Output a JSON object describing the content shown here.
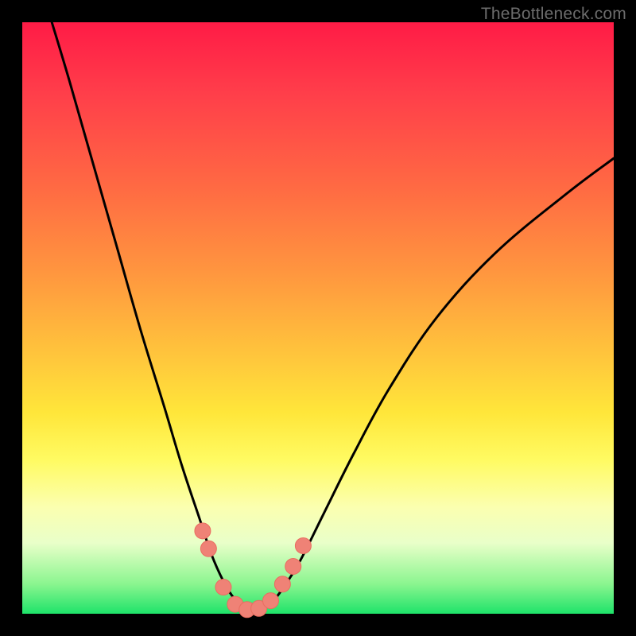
{
  "watermark": "TheBottleneck.com",
  "colors": {
    "curve_stroke": "#000000",
    "marker_fill": "#ef8276",
    "marker_stroke": "#e96d60",
    "frame": "#000000"
  },
  "chart_data": {
    "type": "line",
    "title": "",
    "xlabel": "",
    "ylabel": "",
    "xlim": [
      0,
      100
    ],
    "ylim": [
      0,
      100
    ],
    "grid": false,
    "legend": false,
    "series": [
      {
        "name": "bottleneck-curve",
        "x": [
          5,
          8,
          12,
          16,
          20,
          24,
          27,
          30,
          32,
          34,
          35.5,
          37,
          38.5,
          40,
          42,
          44,
          47,
          51,
          56,
          62,
          70,
          80,
          92,
          100
        ],
        "y": [
          100,
          90,
          76,
          62,
          48,
          35,
          25,
          16,
          10,
          5.5,
          3,
          1.3,
          0.6,
          0.7,
          1.8,
          4.2,
          9,
          17,
          27,
          38,
          50,
          61,
          71,
          77
        ]
      }
    ],
    "markers": [
      {
        "x": 30.5,
        "y": 14
      },
      {
        "x": 31.5,
        "y": 11
      },
      {
        "x": 34,
        "y": 4.5
      },
      {
        "x": 36,
        "y": 1.6
      },
      {
        "x": 38,
        "y": 0.7
      },
      {
        "x": 40,
        "y": 0.9
      },
      {
        "x": 42,
        "y": 2.2
      },
      {
        "x": 44,
        "y": 5.0
      },
      {
        "x": 45.8,
        "y": 8.0
      },
      {
        "x": 47.5,
        "y": 11.5
      }
    ]
  }
}
